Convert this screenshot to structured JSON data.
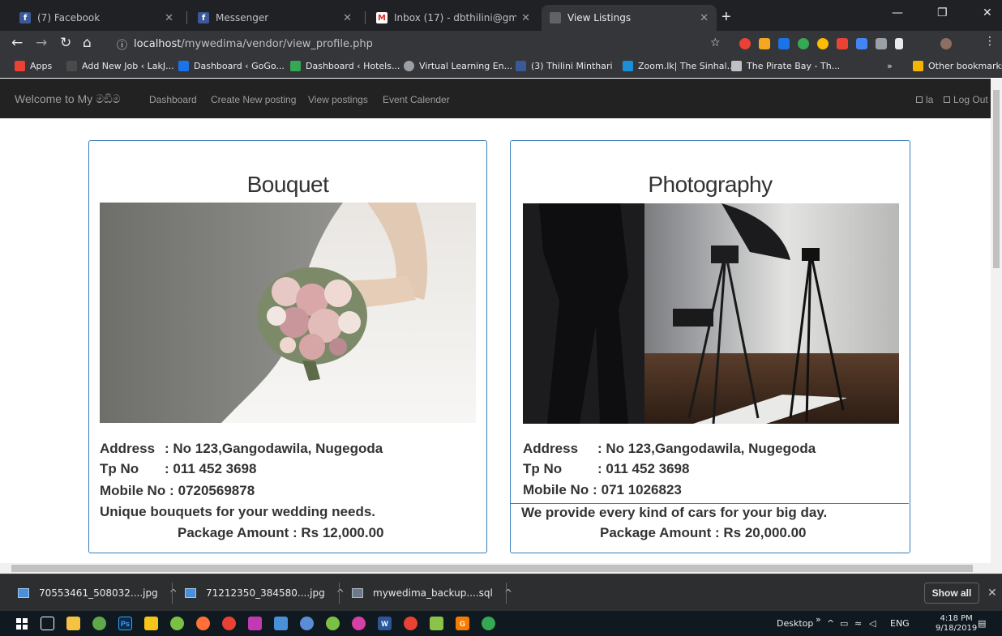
{
  "browser": {
    "tabs": [
      {
        "title": "(7) Facebook",
        "icon": "facebook-icon",
        "color": "#3b5998"
      },
      {
        "title": "Messenger",
        "icon": "facebook-icon",
        "color": "#3b5998"
      },
      {
        "title": "Inbox (17) - dbthilini@gmail.com",
        "icon": "gmail-icon",
        "color": "#d93025"
      },
      {
        "title": "View Listings",
        "icon": "page-icon",
        "color": "#5f6368"
      }
    ],
    "url_host": "localhost",
    "url_path": "/mywedima/vendor/view_profile.php",
    "bookmarks": [
      {
        "label": "Apps",
        "color": "#e94235"
      },
      {
        "label": "Add New Job ‹ LakJ...",
        "color": "#4a4a4a"
      },
      {
        "label": "Dashboard ‹ GoGo...",
        "color": "#1a73e8"
      },
      {
        "label": "Dashboard ‹ Hotels...",
        "color": "#34a853"
      },
      {
        "label": "Virtual Learning En...",
        "color": "#9aa0a6"
      },
      {
        "label": "(3) Thilini Minthari",
        "color": "#3b5998"
      },
      {
        "label": "Zoom.lk| The Sinhal...",
        "color": "#1a8fd8"
      },
      {
        "label": "The Pirate Bay - Th...",
        "color": "#bdc1c6"
      }
    ],
    "other_bookmarks": "Other bookmarks",
    "overflow": "»"
  },
  "nav": {
    "brand": "Welcome to My මඞිම",
    "links": [
      "Dashboard",
      "Create New posting",
      "View postings",
      "Event Calender"
    ],
    "user": "la",
    "logout": "Log Out"
  },
  "cards": [
    {
      "title": "Bouquet",
      "address_label": "Address",
      "address": ": No 123,Gangodawila, Nugegoda",
      "tp_label": "Tp No",
      "tp": ": 011 452 3698",
      "mobile_label": "Mobile No :",
      "mobile": "0720569878",
      "description": "Unique bouquets for your wedding needs.",
      "package": "Package Amount : Rs 12,000.00"
    },
    {
      "title": "Photography",
      "address_label": "Address",
      "address": ": No 123,Gangodawila, Nugegoda",
      "tp_label": "Tp No",
      "tp": ": 011 452 3698",
      "mobile_label": "Mobile No :",
      "mobile": "071 1026823",
      "description": "We provide every kind of cars for your big day.",
      "package": "Package Amount : Rs 20,000.00"
    }
  ],
  "downloads": {
    "items": [
      "70553461_508032....jpg",
      "71212350_384580....jpg",
      "mywedima_backup....sql"
    ],
    "show_all": "Show all"
  },
  "taskbar": {
    "desktop": "Desktop",
    "lang": "ENG",
    "time": "4:18 PM",
    "date": "9/18/2019"
  }
}
